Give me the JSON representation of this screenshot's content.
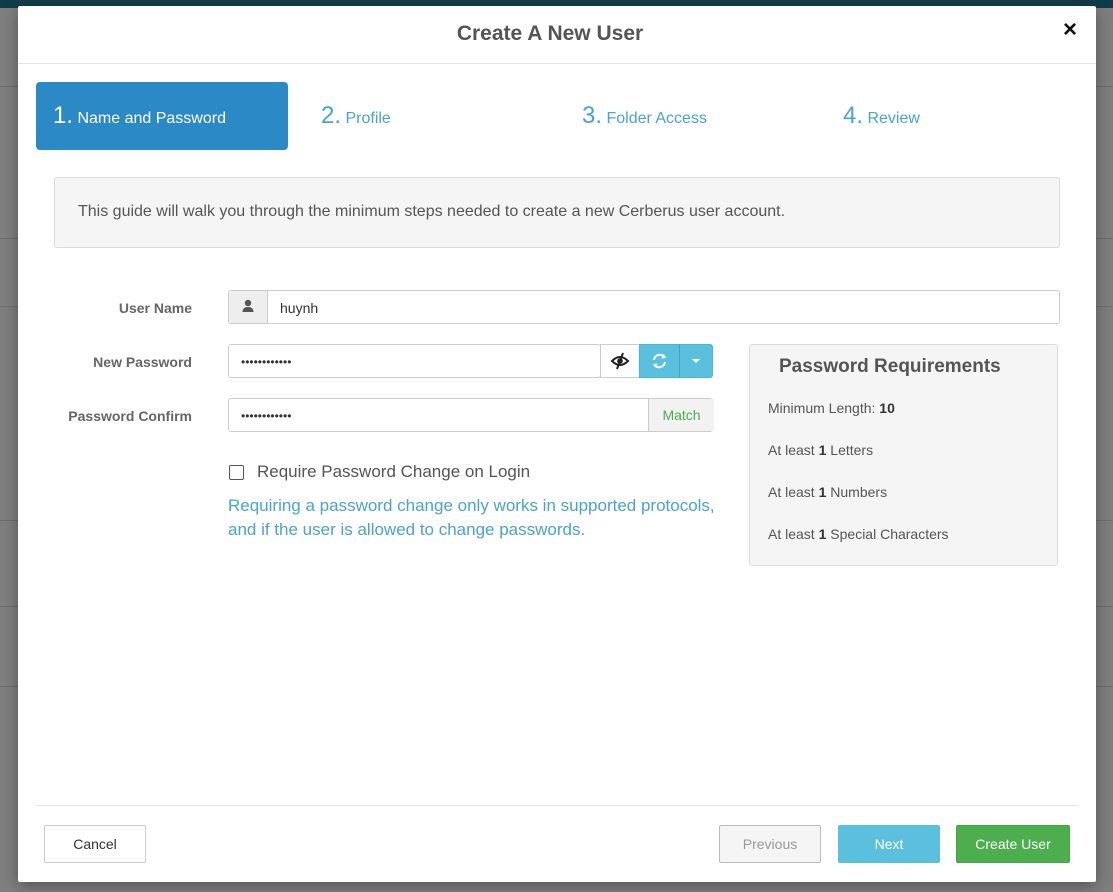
{
  "modal": {
    "title": "Create A New User",
    "close_label": "×"
  },
  "steps": [
    {
      "num": "1.",
      "label": "Name and Password",
      "active": true
    },
    {
      "num": "2.",
      "label": "Profile",
      "active": false
    },
    {
      "num": "3.",
      "label": "Folder Access",
      "active": false
    },
    {
      "num": "4.",
      "label": "Review",
      "active": false
    }
  ],
  "guide": {
    "text": "This guide will walk you through the minimum steps needed to create a new Cerberus user account."
  },
  "form": {
    "username_label": "User Name",
    "username_value": "huynh",
    "new_password_label": "New Password",
    "new_password_value": "••••••••••••",
    "password_confirm_label": "Password Confirm",
    "password_confirm_value": "••••••••••••",
    "match_label": "Match",
    "require_change_label": "Require Password Change on Login",
    "require_change_checked": false,
    "help_text": "Requiring a password change only works in supported protocols, and if the user is allowed to change passwords."
  },
  "requirements": {
    "title": "Password Requirements",
    "min_length_prefix": "Minimum Length: ",
    "min_length_value": "10",
    "letters_prefix": "At least ",
    "letters_value": "1",
    "letters_suffix": " Letters",
    "numbers_prefix": "At least ",
    "numbers_value": "1",
    "numbers_suffix": " Numbers",
    "special_prefix": "At least ",
    "special_value": "1",
    "special_suffix": " Special Characters"
  },
  "footer": {
    "cancel": "Cancel",
    "previous": "Previous",
    "next": "Next",
    "create": "Create User"
  },
  "colors": {
    "active_step": "#2b8ac6",
    "step_link": "#4aa3d0",
    "match": "#4cae4c",
    "next_button": "#5bc0de",
    "create_button": "#4cae4c"
  }
}
